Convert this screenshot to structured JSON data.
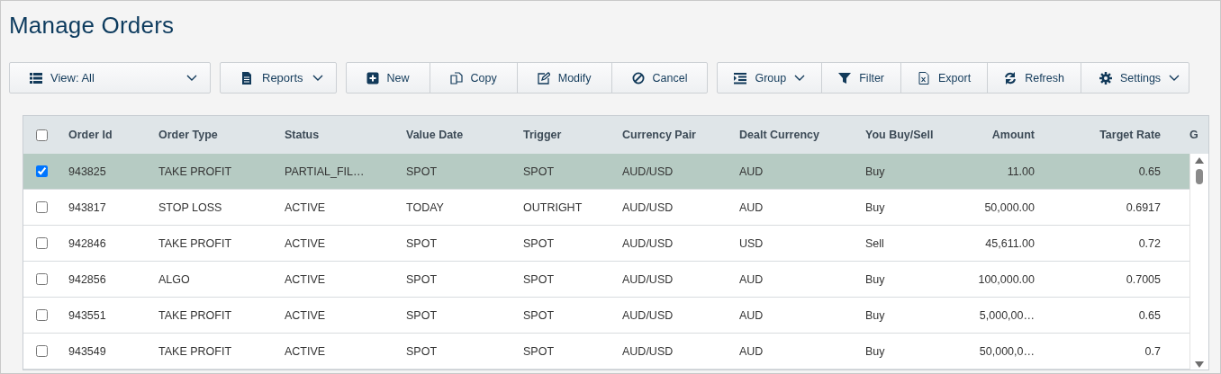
{
  "title": "Manage Orders",
  "toolbar": [
    {
      "items": [
        {
          "label": "View: All",
          "dropdown": true
        }
      ]
    },
    {
      "items": [
        {
          "label": "Reports",
          "dropdown": true
        }
      ]
    },
    {
      "items": [
        {
          "label": "New",
          "dropdown": false
        },
        {
          "label": "Copy",
          "dropdown": false
        },
        {
          "label": "Modify",
          "dropdown": false
        },
        {
          "label": "Cancel",
          "dropdown": false
        }
      ]
    },
    {
      "items": [
        {
          "label": "Group",
          "dropdown": true
        },
        {
          "label": "Filter",
          "dropdown": false
        },
        {
          "label": "Export",
          "dropdown": false
        },
        {
          "label": "Refresh",
          "dropdown": false
        },
        {
          "label": "Settings",
          "dropdown": true
        }
      ]
    }
  ],
  "table": {
    "all_checked": false,
    "columns": [
      "Order Id",
      "Order Type",
      "Status",
      "Value Date",
      "Trigger",
      "Currency Pair",
      "Dealt Currency",
      "You Buy/Sell",
      "Amount",
      "Target Rate",
      "G"
    ],
    "rows": [
      {
        "selected": true,
        "cells": [
          "943825",
          "TAKE PROFIT",
          "PARTIAL_FIL…",
          "SPOT",
          "SPOT",
          "AUD/USD",
          "AUD",
          "Buy",
          "11.00",
          "0.65"
        ]
      },
      {
        "selected": false,
        "cells": [
          "943817",
          "STOP LOSS",
          "ACTIVE",
          "TODAY",
          "OUTRIGHT",
          "AUD/USD",
          "AUD",
          "Buy",
          "50,000.00",
          "0.6917"
        ]
      },
      {
        "selected": false,
        "cells": [
          "942846",
          "TAKE PROFIT",
          "ACTIVE",
          "SPOT",
          "SPOT",
          "AUD/USD",
          "USD",
          "Sell",
          "45,611.00",
          "0.72"
        ]
      },
      {
        "selected": false,
        "cells": [
          "942856",
          "ALGO",
          "ACTIVE",
          "SPOT",
          "SPOT",
          "AUD/USD",
          "AUD",
          "Buy",
          "100,000.00",
          "0.7005"
        ]
      },
      {
        "selected": false,
        "cells": [
          "943551",
          "TAKE PROFIT",
          "ACTIVE",
          "SPOT",
          "SPOT",
          "AUD/USD",
          "AUD",
          "Buy",
          "5,000,00…",
          "0.65"
        ]
      },
      {
        "selected": false,
        "cells": [
          "943549",
          "TAKE PROFIT",
          "ACTIVE",
          "SPOT",
          "SPOT",
          "AUD/USD",
          "AUD",
          "Buy",
          "50,000,0…",
          "0.7"
        ]
      }
    ]
  }
}
